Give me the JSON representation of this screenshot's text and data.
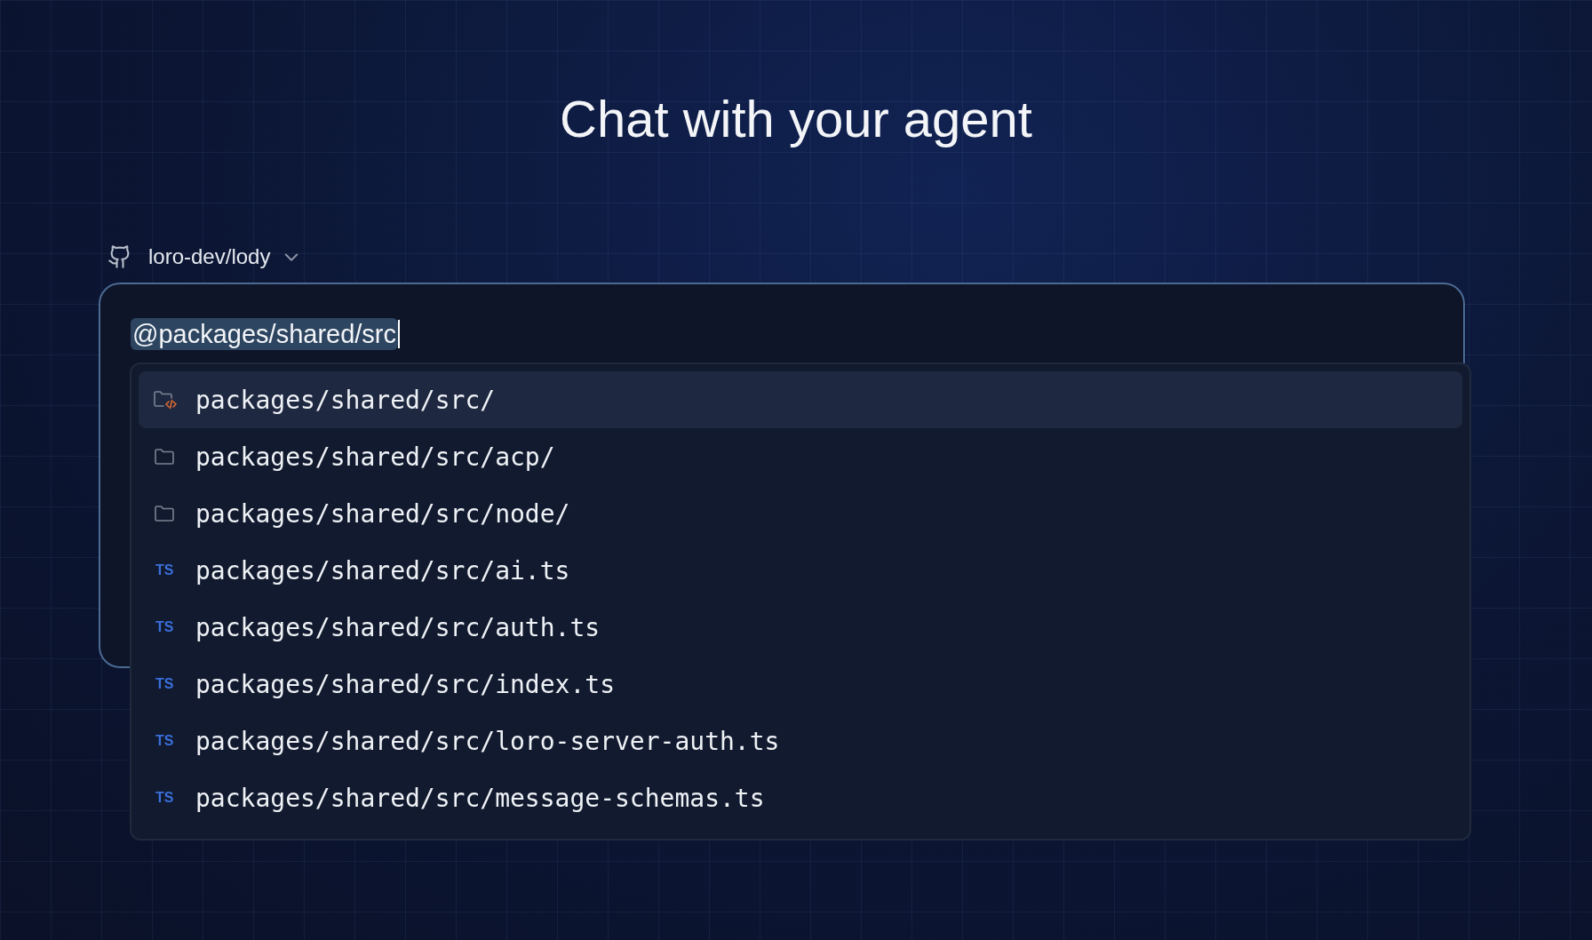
{
  "title": "Chat with your agent",
  "repo": {
    "name": "loro-dev/lody"
  },
  "input": {
    "value": "@packages/shared/src",
    "selection_highlighted": true
  },
  "suggestions": [
    {
      "kind": "source-folder",
      "label": "packages/shared/src/",
      "selected": true
    },
    {
      "kind": "folder",
      "label": "packages/shared/src/acp/",
      "selected": false
    },
    {
      "kind": "folder",
      "label": "packages/shared/src/node/",
      "selected": false
    },
    {
      "kind": "ts",
      "badge": "TS",
      "label": "packages/shared/src/ai.ts",
      "selected": false
    },
    {
      "kind": "ts",
      "badge": "TS",
      "label": "packages/shared/src/auth.ts",
      "selected": false
    },
    {
      "kind": "ts",
      "badge": "TS",
      "label": "packages/shared/src/index.ts",
      "selected": false
    },
    {
      "kind": "ts",
      "badge": "TS",
      "label": "packages/shared/src/loro-server-auth.ts",
      "selected": false
    },
    {
      "kind": "ts",
      "badge": "TS",
      "label": "packages/shared/src/message-schemas.ts",
      "selected": false
    }
  ]
}
